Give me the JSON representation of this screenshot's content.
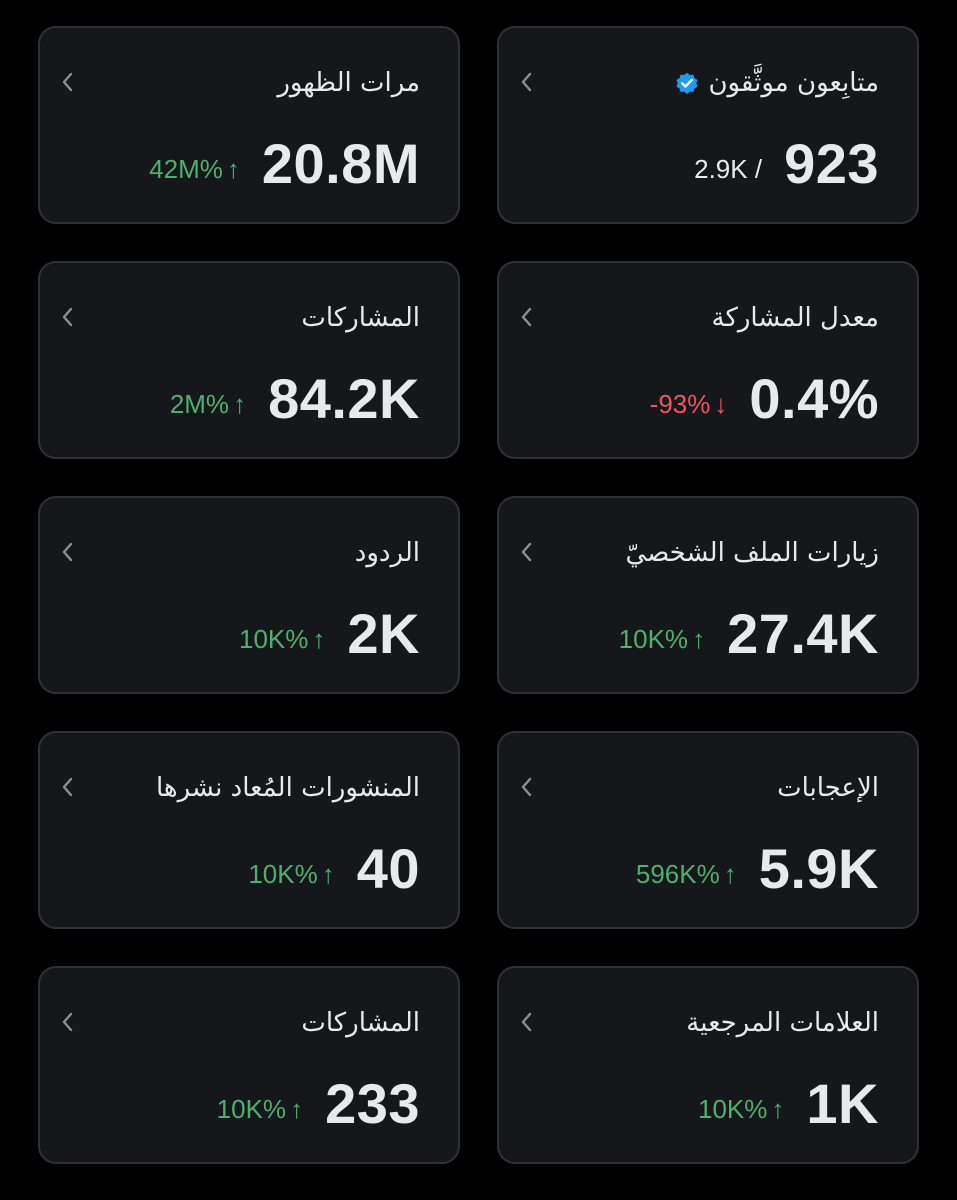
{
  "colors": {
    "background": "#000000",
    "card_background": "#16171b",
    "card_border": "#2f3136",
    "text": "#e7e9ea",
    "positive": "#4db06d",
    "negative": "#f0545f",
    "verified_badge": "#1d9bf0"
  },
  "cards": {
    "impressions": {
      "title": "مرات الظهور",
      "value": "20.8M",
      "change": "42M%",
      "direction": "up"
    },
    "verified_followers": {
      "title": "متابِعون موثَّقون",
      "value": "923",
      "secondary": "2.9K /",
      "icon": "verified-badge-icon"
    },
    "engagements": {
      "title": "المشاركات",
      "value": "84.2K",
      "change": "2M%",
      "direction": "up"
    },
    "engagement_rate": {
      "title": "معدل المشاركة",
      "value": "0.4%",
      "change": "-93%",
      "direction": "down"
    },
    "replies": {
      "title": "الردود",
      "value": "2K",
      "change": "10K%",
      "direction": "up"
    },
    "profile_visits": {
      "title": "زيارات الملف الشخصيّ",
      "value": "27.4K",
      "change": "10K%",
      "direction": "up"
    },
    "reposts": {
      "title": "المنشورات المُعاد نشرها",
      "value": "40",
      "change": "10K%",
      "direction": "up"
    },
    "likes": {
      "title": "الإعجابات",
      "value": "5.9K",
      "change": "596K%",
      "direction": "up"
    },
    "shares": {
      "title": "المشاركات",
      "value": "233",
      "change": "10K%",
      "direction": "up"
    },
    "bookmarks": {
      "title": "العلامات المرجعية",
      "value": "1K",
      "change": "10K%",
      "direction": "up"
    }
  },
  "icons": {
    "chevron": "chevron-left-icon",
    "up_arrow": "↑",
    "down_arrow": "↓"
  }
}
